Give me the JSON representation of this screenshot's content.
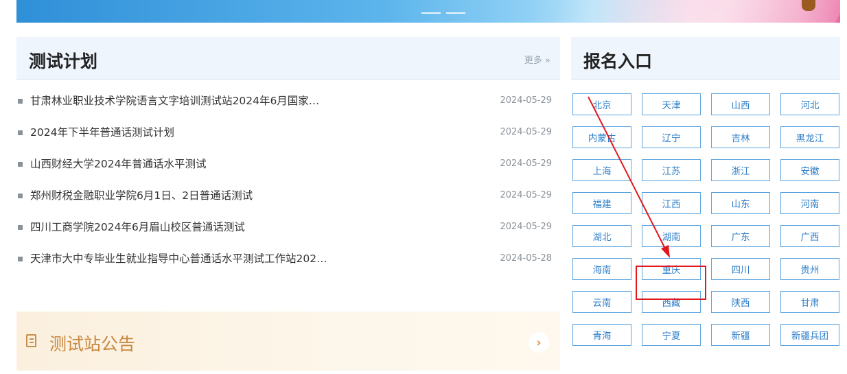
{
  "plan": {
    "title": "测试计划",
    "more": "更多 »",
    "items": [
      {
        "text": "甘肃林业职业技术学院语言文字培训测试站2024年6月国家…",
        "date": "2024-05-29"
      },
      {
        "text": "2024年下半年普通话测试计划",
        "date": "2024-05-29"
      },
      {
        "text": "山西财经大学2024年普通话水平测试",
        "date": "2024-05-29"
      },
      {
        "text": "郑州财税金融职业学院6月1日、2日普通话测试",
        "date": "2024-05-29"
      },
      {
        "text": "四川工商学院2024年6月眉山校区普通话测试",
        "date": "2024-05-29"
      },
      {
        "text": "天津市大中专毕业生就业指导中心普通话水平测试工作站202…",
        "date": "2024-05-28"
      }
    ]
  },
  "notice": {
    "title": "测试站公告",
    "go": "›",
    "icon": "document-icon"
  },
  "registration": {
    "title": "报名入口",
    "provinces": [
      "北京",
      "天津",
      "山西",
      "河北",
      "内蒙古",
      "辽宁",
      "吉林",
      "黑龙江",
      "上海",
      "江苏",
      "浙江",
      "安徽",
      "福建",
      "江西",
      "山东",
      "河南",
      "湖北",
      "湖南",
      "广东",
      "广西",
      "海南",
      "重庆",
      "四川",
      "贵州",
      "云南",
      "西藏",
      "陕西",
      "甘肃",
      "青海",
      "宁夏",
      "新疆",
      "新疆兵团"
    ]
  },
  "annotation": {
    "color": "#e0191c",
    "highlighted": "重庆"
  }
}
